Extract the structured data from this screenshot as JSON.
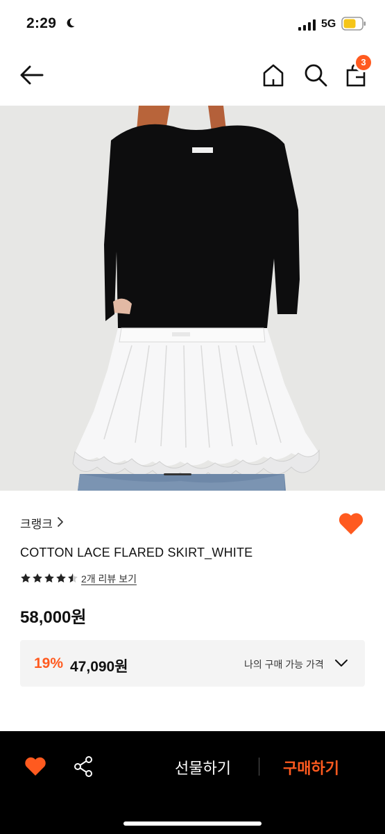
{
  "status": {
    "time": "2:29",
    "network": "5G",
    "colors": {
      "battery": "#f5c518"
    }
  },
  "nav": {
    "cart_count": "3",
    "icons": [
      "back-arrow-icon",
      "home-icon",
      "search-icon",
      "shopping-bag-icon"
    ]
  },
  "product": {
    "brand": "크랭크",
    "title": "COTTON LACE FLARED SKIRT_WHITE",
    "rating": 4.5,
    "review_link": "2개 리뷰 보기",
    "price": "58,000원",
    "discount": "19%",
    "sale_price": "47,090원",
    "my_price_label": "나의 구매 가능 가격"
  },
  "actions": {
    "gift_label": "선물하기",
    "buy_label": "구매하기"
  },
  "colors": {
    "accent": "#ff5a1f",
    "bottom_bar": "#000000"
  }
}
